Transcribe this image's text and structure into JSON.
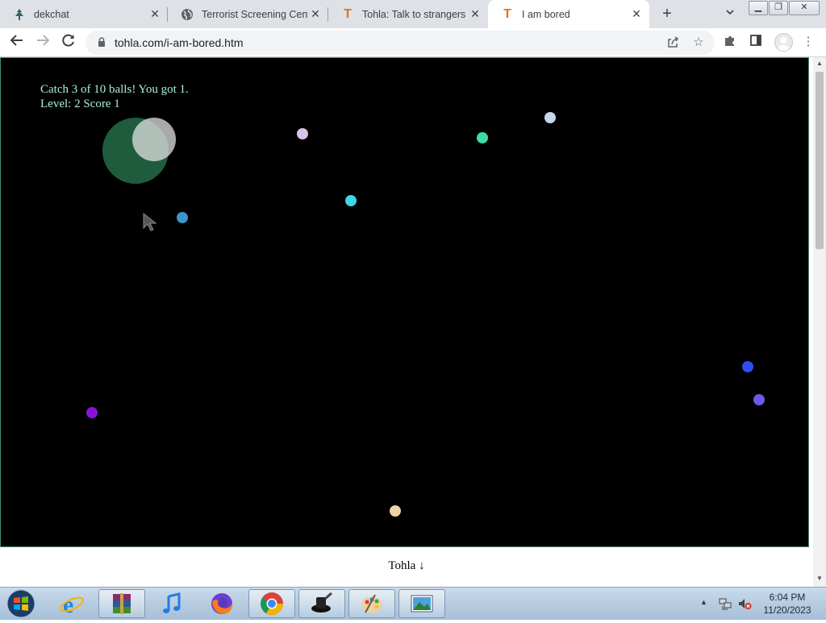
{
  "tabs": [
    {
      "title": "dekchat",
      "icon": "dekchat-icon",
      "active": false
    },
    {
      "title": "Terrorist Screening Center",
      "icon": "globe-icon",
      "active": false
    },
    {
      "title": "Tohla: Talk to strangers",
      "icon": "tohla-t-icon",
      "active": false
    },
    {
      "title": "I am bored",
      "icon": "tohla-t-icon",
      "active": true
    }
  ],
  "toolbar": {
    "url": "tohla.com/i-am-bored.htm"
  },
  "game": {
    "message": "Catch 3 of 10 balls! You got 1.",
    "level_line": "Level: 2 Score 1",
    "ball_colors": [
      "#d9c2e8",
      "#3ddba9",
      "#c7d6e8",
      "#3ad8e6",
      "#3d96c9",
      "#2d4ef0",
      "#6a5ce8",
      "#8a12d8",
      "#f0d4a4"
    ]
  },
  "footer": {
    "link": "Tohla ↓"
  },
  "taskbar": {
    "apps": [
      "internet-explorer-icon",
      "winrar-icon",
      "itunes-icon",
      "firefox-icon",
      "chrome-icon",
      "ink-app-icon",
      "paint-icon",
      "photo-viewer-icon"
    ],
    "time": "6:04 PM",
    "date": "11/20/2023"
  }
}
